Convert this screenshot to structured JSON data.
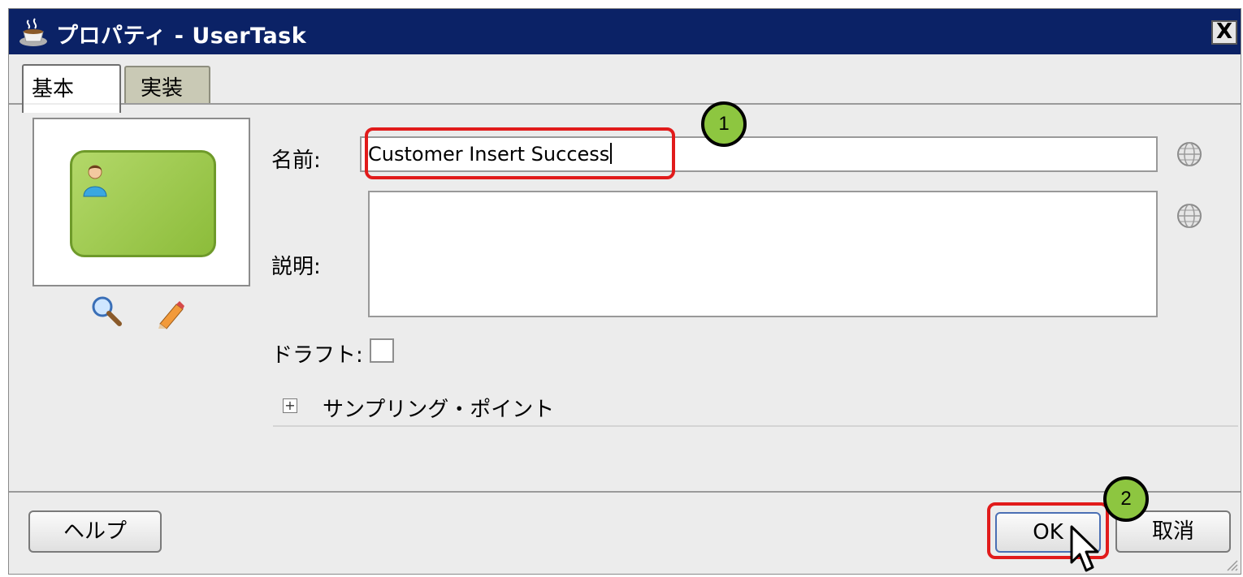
{
  "window": {
    "title": "プロパティ - UserTask",
    "close_label": "X"
  },
  "tabs": [
    {
      "label": "基本",
      "active": true
    },
    {
      "label": "実装",
      "active": false
    }
  ],
  "form": {
    "name_label": "名前:",
    "name_value": "Customer Insert Success",
    "description_label": "説明:",
    "description_value": "",
    "draft_label": "ドラフト:",
    "draft_checked": false,
    "sampling_label": "サンプリング・ポイント",
    "expand_symbol": "+"
  },
  "buttons": {
    "help": "ヘルプ",
    "ok": "OK",
    "cancel": "取消"
  },
  "callouts": {
    "one": "1",
    "two": "2"
  },
  "icons": {
    "title": "coffee-cup-icon",
    "task": "user-icon",
    "zoom": "magnifier-icon",
    "edit": "pencil-icon",
    "translate": "globe-icon",
    "expand": "plus-box-icon",
    "cursor": "mouse-pointer-icon"
  },
  "colors": {
    "titlebar": "#0b2266",
    "task_fill": "#9cc84a",
    "highlight": "#e11b1b",
    "callout": "#8dc640"
  }
}
